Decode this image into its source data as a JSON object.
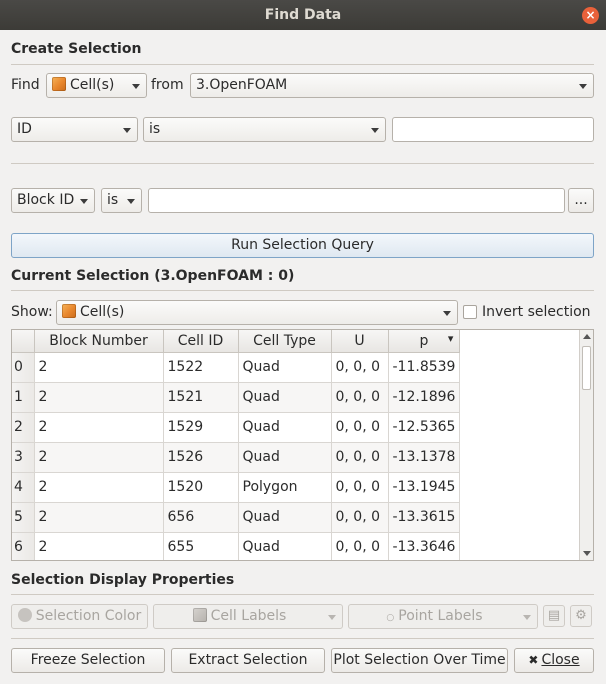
{
  "window": {
    "title": "Find Data",
    "close_glyph": "×"
  },
  "create_selection": {
    "title": "Create Selection",
    "find_label": "Find",
    "find_value": "Cell(s)",
    "from_label": "from",
    "from_value": "3.OpenFOAM",
    "query1": {
      "field": "ID",
      "op": "is",
      "value": ""
    },
    "query2": {
      "field": "Block ID",
      "op": "is",
      "value": "",
      "more_label": "..."
    },
    "run_label": "Run Selection Query"
  },
  "current_selection": {
    "title": "Current Selection (3.OpenFOAM : 0)",
    "show_label": "Show:",
    "show_value": "Cell(s)",
    "invert_label": "Invert selection",
    "columns": [
      "Block Number",
      "Cell ID",
      "Cell Type",
      "U",
      "p"
    ],
    "sort_indicator": "▾",
    "rows": [
      {
        "idx": "0",
        "block": "2",
        "cell_id": "1522",
        "type": "Quad",
        "u": "0, 0, 0",
        "p": "-11.8539"
      },
      {
        "idx": "1",
        "block": "2",
        "cell_id": "1521",
        "type": "Quad",
        "u": "0, 0, 0",
        "p": "-12.1896"
      },
      {
        "idx": "2",
        "block": "2",
        "cell_id": "1529",
        "type": "Quad",
        "u": "0, 0, 0",
        "p": "-12.5365"
      },
      {
        "idx": "3",
        "block": "2",
        "cell_id": "1526",
        "type": "Quad",
        "u": "0, 0, 0",
        "p": "-13.1378"
      },
      {
        "idx": "4",
        "block": "2",
        "cell_id": "1520",
        "type": "Polygon",
        "u": "0, 0, 0",
        "p": "-13.1945"
      },
      {
        "idx": "5",
        "block": "2",
        "cell_id": "656",
        "type": "Quad",
        "u": "0, 0, 0",
        "p": "-13.3615"
      },
      {
        "idx": "6",
        "block": "2",
        "cell_id": "655",
        "type": "Quad",
        "u": "0, 0, 0",
        "p": "-13.3646"
      }
    ]
  },
  "display_props": {
    "title": "Selection Display Properties",
    "color_label": "Selection Color",
    "cell_labels": "Cell Labels",
    "point_labels": "Point Labels"
  },
  "footer": {
    "freeze": "Freeze Selection",
    "extract": "Extract Selection",
    "plot": "Plot Selection Over Time",
    "close": "Close",
    "close_glyph": "✖"
  }
}
